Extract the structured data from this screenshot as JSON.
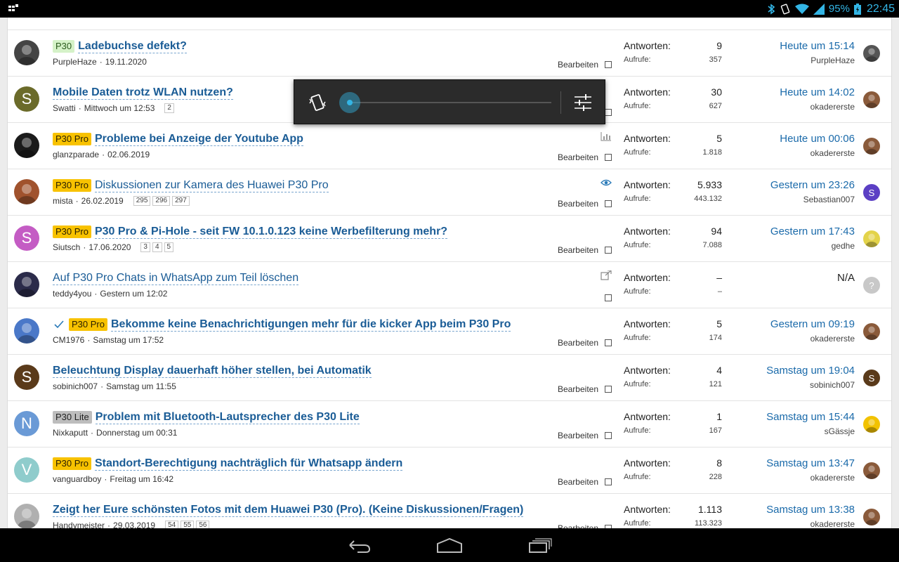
{
  "status_bar": {
    "battery": "95%",
    "time": "22:45",
    "accent_color": "#33b5e5",
    "icons": [
      "notification-icon",
      "bluetooth-icon",
      "vibrate-icon",
      "wifi-icon",
      "signal-icon",
      "battery-icon"
    ]
  },
  "threads": [
    {
      "avatar": {
        "type": "photo",
        "letter": "",
        "color": "#444444"
      },
      "prefix": "P30",
      "prefix_style": "p30",
      "title": "Ladebuchse defekt?",
      "bold": true,
      "solved": false,
      "author": "PurpleHaze",
      "date": "19.11.2020",
      "pages": [],
      "icon": "",
      "edit_label": "Bearbeiten",
      "replies_label": "Antworten:",
      "replies": "9",
      "views_label": "Aufrufe:",
      "views": "357",
      "last_time": "Heute um 15:14",
      "last_user": "PurpleHaze",
      "last_avatar": {
        "type": "photo",
        "letter": "",
        "color": "#555555"
      }
    },
    {
      "avatar": {
        "type": "letter",
        "letter": "S",
        "color": "#6b6b2a"
      },
      "prefix": "",
      "prefix_style": "",
      "title": "Mobile Daten trotz WLAN nutzen?",
      "bold": true,
      "solved": false,
      "author": "Swatti",
      "date": "Mittwoch um 12:53",
      "pages": [
        "2"
      ],
      "icon": "",
      "edit_label": "",
      "replies_label": "Antworten:",
      "replies": "30",
      "views_label": "Aufrufe:",
      "views": "627",
      "last_time": "Heute um 14:02",
      "last_user": "okadererste",
      "last_avatar": {
        "type": "photo",
        "letter": "",
        "color": "#8a5a3a"
      }
    },
    {
      "avatar": {
        "type": "photo",
        "letter": "",
        "color": "#1b1b1b"
      },
      "prefix": "P30 Pro",
      "prefix_style": "p30pro",
      "title": "Probleme bei Anzeige der Youtube App",
      "bold": true,
      "solved": false,
      "author": "glanzparade",
      "date": "02.06.2019",
      "pages": [],
      "icon": "chart-icon",
      "edit_label": "Bearbeiten",
      "replies_label": "Antworten:",
      "replies": "5",
      "views_label": "Aufrufe:",
      "views": "1.818",
      "last_time": "Heute um 00:06",
      "last_user": "okadererste",
      "last_avatar": {
        "type": "photo",
        "letter": "",
        "color": "#8a5a3a"
      }
    },
    {
      "avatar": {
        "type": "photo",
        "letter": "",
        "color": "#a0522d"
      },
      "prefix": "P30 Pro",
      "prefix_style": "p30pro",
      "title": "Diskussionen zur Kamera des Huawei P30 Pro",
      "bold": false,
      "solved": false,
      "author": "mista",
      "date": "26.02.2019",
      "pages": [
        "295",
        "296",
        "297"
      ],
      "icon": "eye-icon",
      "edit_label": "Bearbeiten",
      "replies_label": "Antworten:",
      "replies": "5.933",
      "views_label": "Aufrufe:",
      "views": "443.132",
      "last_time": "Gestern um 23:26",
      "last_user": "Sebastian007",
      "last_avatar": {
        "type": "letter",
        "letter": "S",
        "color": "#5b3fc4"
      }
    },
    {
      "avatar": {
        "type": "letter",
        "letter": "S",
        "color": "#c45cc4"
      },
      "prefix": "P30 Pro",
      "prefix_style": "p30pro",
      "title": "P30 Pro & Pi-Hole - seit FW 10.1.0.123 keine Werbefilterung mehr?",
      "bold": true,
      "solved": false,
      "author": "Siutsch",
      "date": "17.06.2020",
      "pages": [
        "3",
        "4",
        "5"
      ],
      "icon": "",
      "edit_label": "Bearbeiten",
      "replies_label": "Antworten:",
      "replies": "94",
      "views_label": "Aufrufe:",
      "views": "7.088",
      "last_time": "Gestern um 17:43",
      "last_user": "gedhe",
      "last_avatar": {
        "type": "photo",
        "letter": "",
        "color": "#e3d34a"
      }
    },
    {
      "avatar": {
        "type": "photo",
        "letter": "",
        "color": "#2b2b4a"
      },
      "prefix": "",
      "prefix_style": "",
      "title": "Auf P30 Pro Chats in WhatsApp zum Teil löschen",
      "bold": false,
      "solved": false,
      "author": "teddy4you",
      "date": "Gestern um 12:02",
      "pages": [],
      "icon": "external-link-icon",
      "edit_label": "",
      "replies_label": "Antworten:",
      "replies": "–",
      "views_label": "Aufrufe:",
      "views": "–",
      "last_time": "N/A",
      "last_user": "",
      "last_avatar": {
        "type": "letter",
        "letter": "?",
        "color": "#c8c8c8"
      }
    },
    {
      "avatar": {
        "type": "photo",
        "letter": "",
        "color": "#4a78c8"
      },
      "prefix": "P30 Pro",
      "prefix_style": "p30pro",
      "title": "Bekomme keine Benachrichtigungen mehr für die kicker App beim P30 Pro",
      "bold": true,
      "solved": true,
      "author": "CM1976",
      "date": "Samstag um 17:52",
      "pages": [],
      "icon": "",
      "edit_label": "Bearbeiten",
      "replies_label": "Antworten:",
      "replies": "5",
      "views_label": "Aufrufe:",
      "views": "174",
      "last_time": "Gestern um 09:19",
      "last_user": "okadererste",
      "last_avatar": {
        "type": "photo",
        "letter": "",
        "color": "#8a5a3a"
      }
    },
    {
      "avatar": {
        "type": "letter",
        "letter": "S",
        "color": "#5a3a1a"
      },
      "prefix": "",
      "prefix_style": "",
      "title": "Beleuchtung Display dauerhaft höher stellen, bei Automatik",
      "bold": true,
      "solved": false,
      "author": "sobinich007",
      "date": "Samstag um 11:55",
      "pages": [],
      "icon": "",
      "edit_label": "Bearbeiten",
      "replies_label": "Antworten:",
      "replies": "4",
      "views_label": "Aufrufe:",
      "views": "121",
      "last_time": "Samstag um 19:04",
      "last_user": "sobinich007",
      "last_avatar": {
        "type": "letter",
        "letter": "S",
        "color": "#5a3a1a"
      }
    },
    {
      "avatar": {
        "type": "letter",
        "letter": "N",
        "color": "#6a9ad6"
      },
      "prefix": "P30 Lite",
      "prefix_style": "p30lite",
      "title": "Problem mit Bluetooth-Lautsprecher des P30 Lite",
      "bold": true,
      "solved": false,
      "author": "Nixkaputt",
      "date": "Donnerstag um 00:31",
      "pages": [],
      "icon": "",
      "edit_label": "Bearbeiten",
      "replies_label": "Antworten:",
      "replies": "1",
      "views_label": "Aufrufe:",
      "views": "167",
      "last_time": "Samstag um 15:44",
      "last_user": "sGässje",
      "last_avatar": {
        "type": "photo",
        "letter": "",
        "color": "#f2c200"
      }
    },
    {
      "avatar": {
        "type": "letter",
        "letter": "V",
        "color": "#8fcccc"
      },
      "prefix": "P30 Pro",
      "prefix_style": "p30pro",
      "title": "Standort-Berechtigung nachträglich für Whatsapp ändern",
      "bold": true,
      "solved": false,
      "author": "vanguardboy",
      "date": "Freitag um 16:42",
      "pages": [],
      "icon": "",
      "edit_label": "Bearbeiten",
      "replies_label": "Antworten:",
      "replies": "8",
      "views_label": "Aufrufe:",
      "views": "228",
      "last_time": "Samstag um 13:47",
      "last_user": "okadererste",
      "last_avatar": {
        "type": "photo",
        "letter": "",
        "color": "#8a5a3a"
      }
    },
    {
      "avatar": {
        "type": "photo",
        "letter": "",
        "color": "#b0b0b0"
      },
      "prefix": "",
      "prefix_style": "",
      "title": "Zeigt her Eure schönsten Fotos mit dem Huawei P30 (Pro). (Keine Diskussionen/Fragen)",
      "bold": true,
      "solved": false,
      "author": "Handymeister",
      "date": "29.03.2019",
      "pages": [
        "54",
        "55",
        "56"
      ],
      "icon": "",
      "edit_label": "Bearbeiten",
      "replies_label": "Antworten:",
      "replies": "1.113",
      "views_label": "Aufrufe:",
      "views": "113.323",
      "last_time": "Samstag um 13:38",
      "last_user": "okadererste",
      "last_avatar": {
        "type": "photo",
        "letter": "",
        "color": "#8a5a3a"
      }
    }
  ],
  "volume_panel": {
    "level": 0.0,
    "icons": [
      "vibrate-mode-icon",
      "settings-sliders-icon"
    ]
  },
  "nav_bar": {
    "icons": [
      "back-icon",
      "home-icon",
      "recents-icon"
    ]
  }
}
